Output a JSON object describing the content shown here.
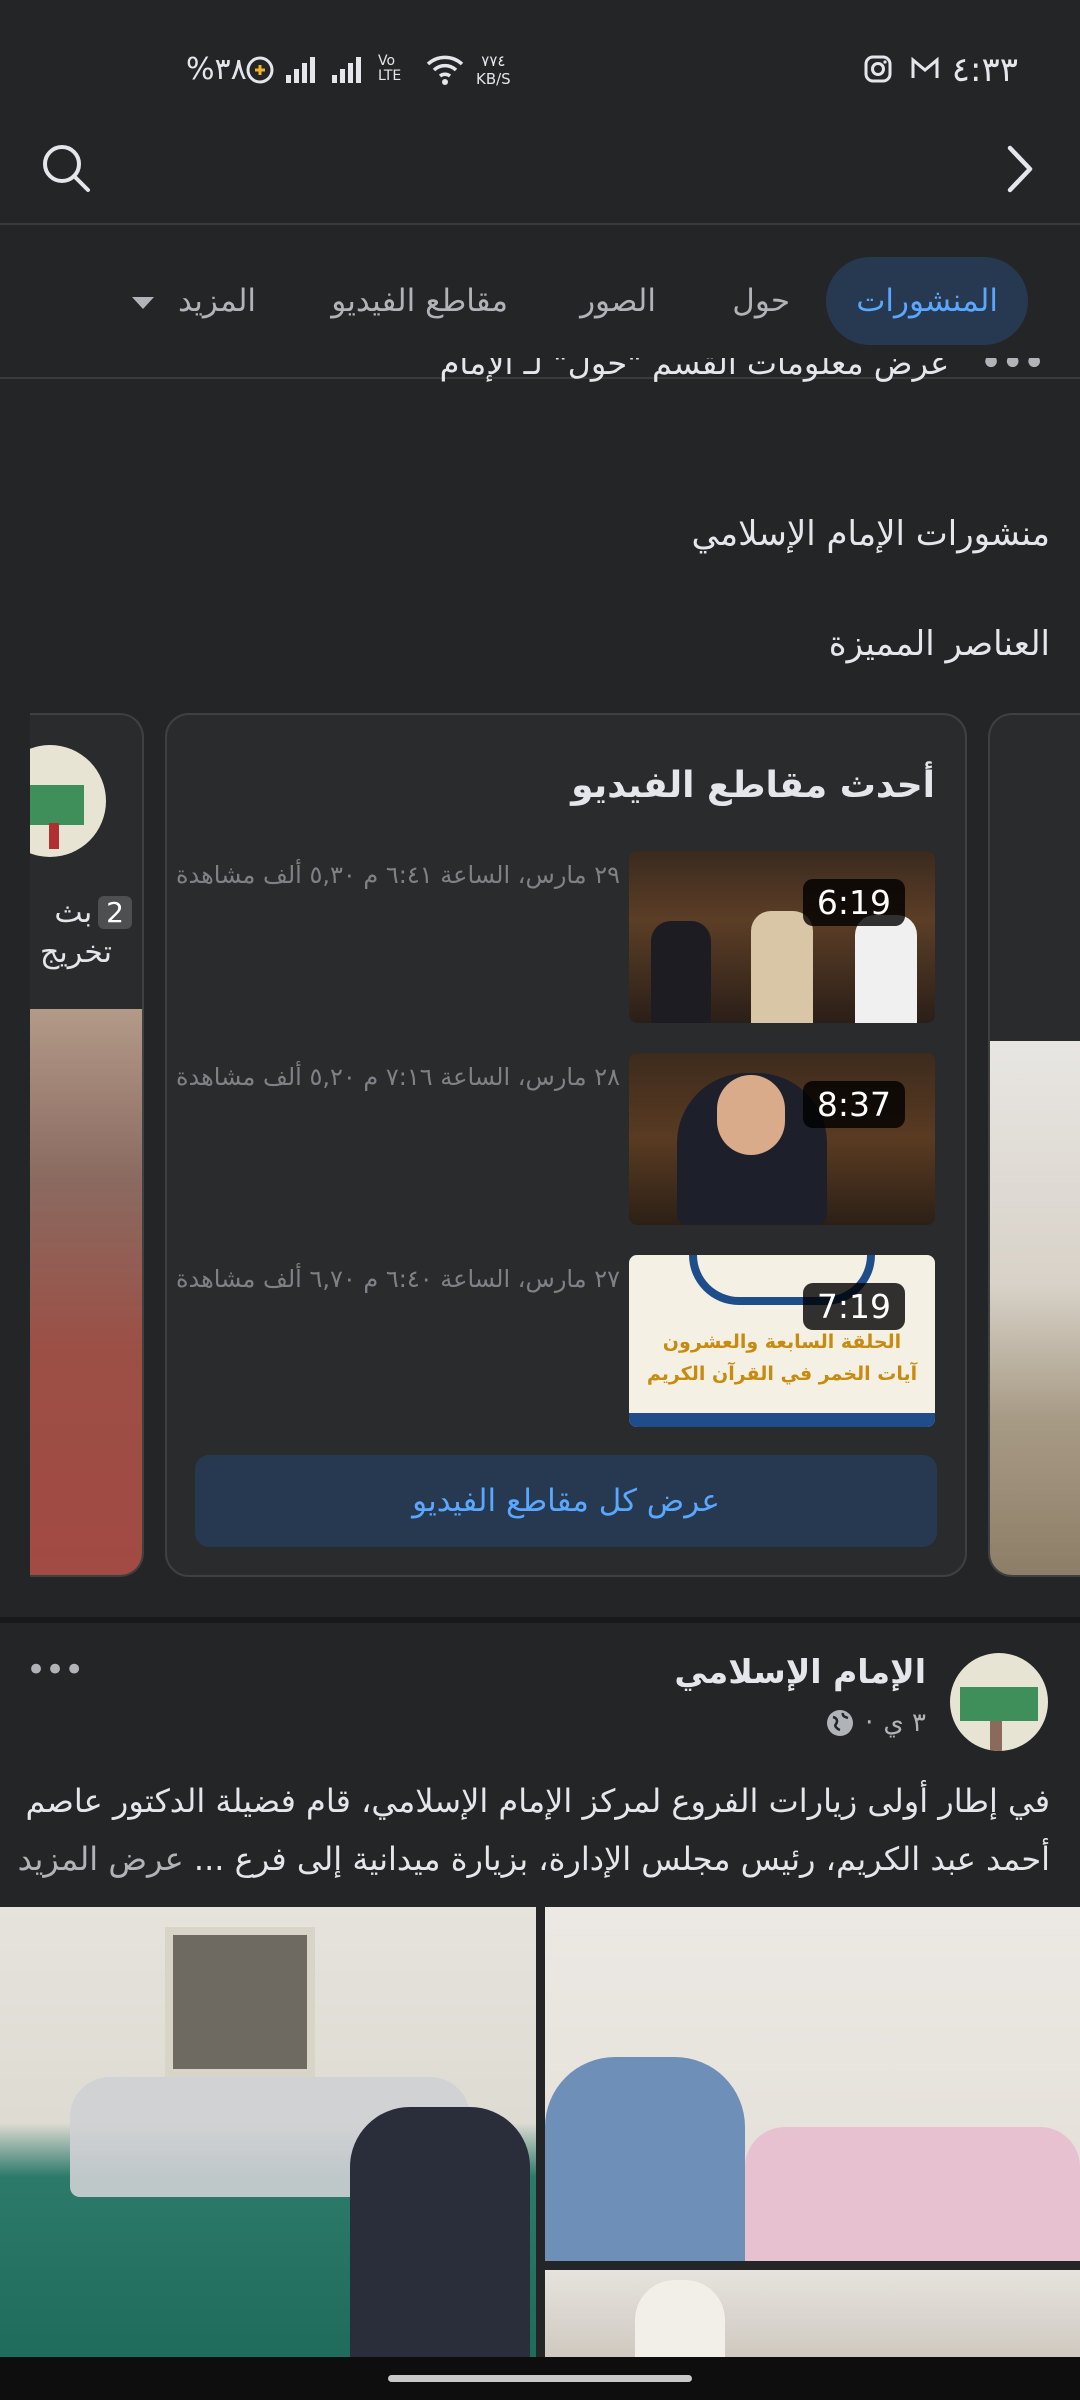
{
  "status_bar": {
    "time": "٤:٣٣",
    "battery": "%٣٨",
    "net_speed_top": "٧٧٤",
    "net_speed_unit": "KB/S",
    "volte": "Vo LTE"
  },
  "tabs": [
    {
      "label": "المنشورات",
      "active": true
    },
    {
      "label": "حول",
      "active": false
    },
    {
      "label": "الصور",
      "active": false
    },
    {
      "label": "مقاطع الفيديو",
      "active": false
    },
    {
      "label": "المزيد",
      "active": false
    }
  ],
  "about_link": "عرض معلومات القسم \"حول\" لـ الإمام",
  "posts_heading": "منشورات الإمام الإسلامي",
  "featured_heading": "العناصر المميزة",
  "featured_card": {
    "title": "أحدث مقاطع الفيديو",
    "videos": [
      {
        "duration": "6:19",
        "meta": "٢٩ مارس، الساعة ٦:٤١ م ٥,٣٠ ألف مشاهدة"
      },
      {
        "duration": "8:37",
        "meta": "٢٨ مارس، الساعة ٧:١٦ م ٥,٢٠ ألف مشاهدة"
      },
      {
        "duration": "7:19",
        "meta": "٢٧ مارس، الساعة ٦:٤٠ م ٦,٧٠ ألف مشاهدة",
        "thumb_line1": "الحلقة السابعة والعشرون",
        "thumb_line2": "آيات الخمر في القرآن الكريم"
      }
    ],
    "button_label": "عرض كل مقاطع الفيديو"
  },
  "left_card": {
    "badge": "2",
    "line1": "بث",
    "line2": "تخريج"
  },
  "post": {
    "author": "الإمام الإسلامي",
    "time": "٣ ي",
    "text_line1": "في إطار أولى زيارات الفروع لمركز الإمام الإسلامي، قام فضيلة الدكتور عاصم",
    "text_line2": "أحمد عبد الكريم، رئيس مجلس الإدارة، بزيارة ميدانية إلى فرع ...",
    "see_more": "عرض المزيد"
  },
  "colors": {
    "background": "#242527",
    "accent": "#5aa7ff",
    "active_tab_bg": "#263951",
    "button_bg": "#263951"
  }
}
